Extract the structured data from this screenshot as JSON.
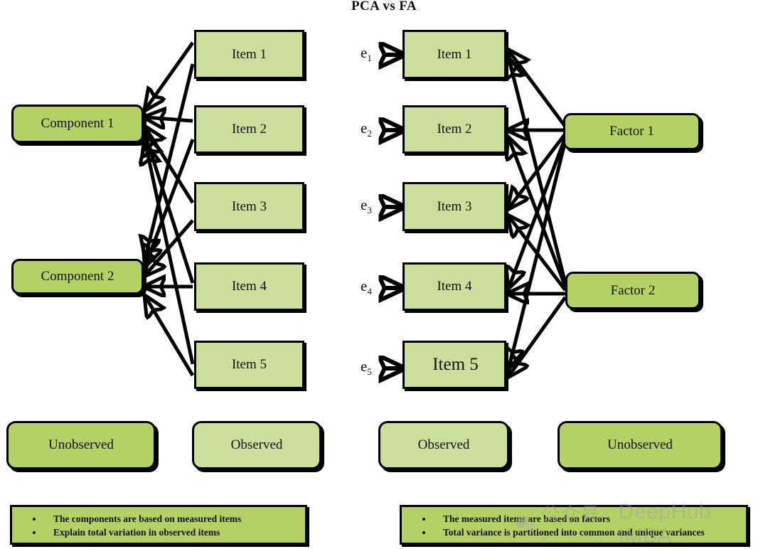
{
  "title": "PCA vs FA",
  "colors": {
    "observed_fill": "#cbdf9d",
    "unobserved_fill": "#b4d165",
    "outline": "#000000",
    "background": "#ffffff",
    "watermark": "#9e9e9e"
  },
  "pca": {
    "items": [
      {
        "label": "Item 1"
      },
      {
        "label": "Item 2"
      },
      {
        "label": "Item 3"
      },
      {
        "label": "Item 4"
      },
      {
        "label": "Item 5"
      }
    ],
    "components": [
      {
        "label": "Component 1"
      },
      {
        "label": "Component 2"
      }
    ],
    "arrow_direction": "items-to-components"
  },
  "fa": {
    "errors": [
      "e1",
      "e2",
      "e3",
      "e4",
      "e5"
    ],
    "error_labels": [
      {
        "base": "e",
        "sub": "1"
      },
      {
        "base": "e",
        "sub": "2"
      },
      {
        "base": "e",
        "sub": "3"
      },
      {
        "base": "e",
        "sub": "4"
      },
      {
        "base": "e",
        "sub": "5"
      }
    ],
    "items": [
      {
        "label": "Item 1"
      },
      {
        "label": "Item 2"
      },
      {
        "label": "Item 3"
      },
      {
        "label": "Item 4"
      },
      {
        "label": "Item 5"
      }
    ],
    "factors": [
      {
        "label": "Factor 1"
      },
      {
        "label": "Factor 2"
      }
    ],
    "arrow_direction": "factors-to-items"
  },
  "legend": [
    {
      "label": "Unobserved",
      "style": "dark"
    },
    {
      "label": "Observed",
      "style": "light"
    },
    {
      "label": "Observed",
      "style": "light"
    },
    {
      "label": "Unobserved",
      "style": "dark"
    }
  ],
  "notes": {
    "left": [
      "The components are based on measured items",
      "Explain total variation in observed items"
    ],
    "right": [
      "The measured items are based on factors",
      "Total variance is partitioned into common and unique  variances"
    ]
  },
  "watermark": {
    "cn": "公众号 -",
    "en": "DeepHub IMBA"
  }
}
